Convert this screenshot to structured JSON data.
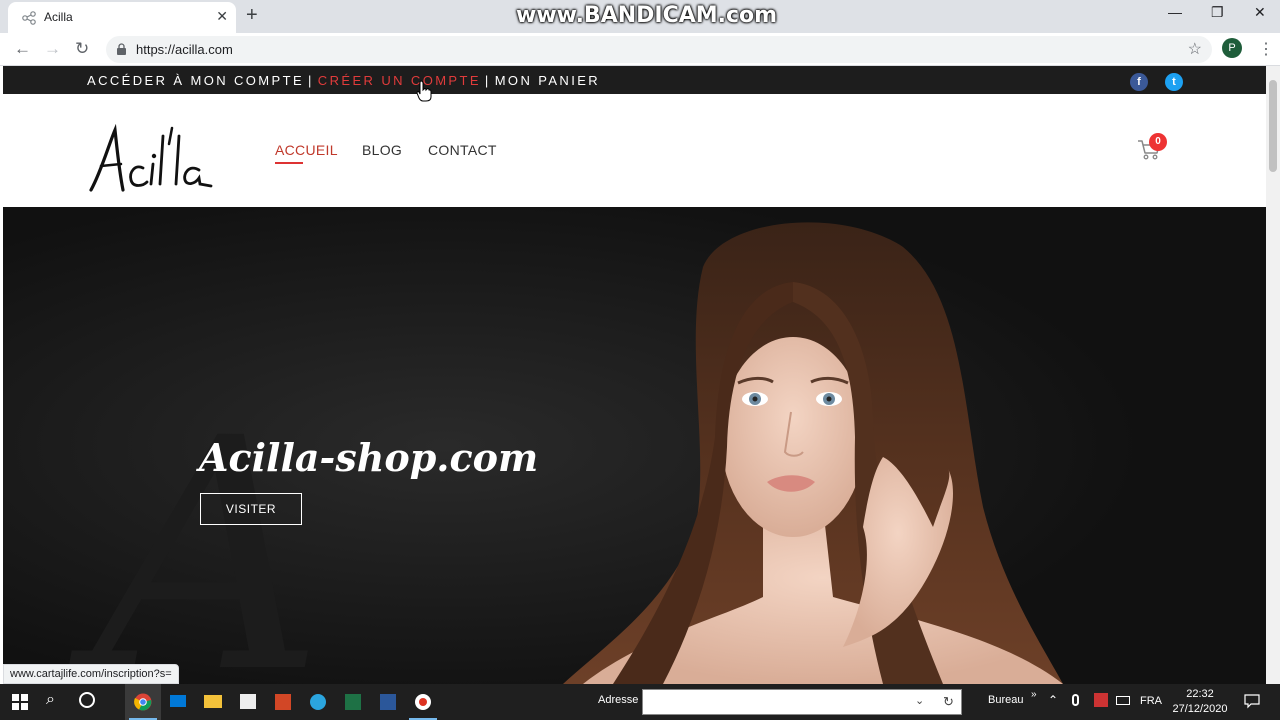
{
  "browser": {
    "tab_title": "Acilla",
    "url": "https://acilla.com",
    "profile_initial": "P",
    "status_url": "www.cartajlife.com/inscription?s="
  },
  "watermark": "www.BANDICAM.com",
  "site": {
    "topbar": {
      "account_link": "ACCÉDER À MON COMPTE",
      "separator": "|",
      "create_account_link": "CRÉER UN COMPTE",
      "cart_link": "MON PANIER"
    },
    "logo_text": "Acilla",
    "nav": [
      {
        "label": "ACCUEIL",
        "active": true
      },
      {
        "label": "BLOG",
        "active": false
      },
      {
        "label": "CONTACT",
        "active": false
      }
    ],
    "cart_count": "0",
    "hero": {
      "title": "Acilla-shop.com",
      "button_label": "VISITER"
    },
    "colors": {
      "accent": "#e03b3b",
      "topbar": "#1d1d1d",
      "facebook": "#3b5998",
      "twitter": "#1da1f2"
    }
  },
  "taskbar": {
    "address_label": "Adresse",
    "desktop_label": "Bureau",
    "language": "FRA",
    "time": "22:32",
    "date": "27/12/2020"
  }
}
